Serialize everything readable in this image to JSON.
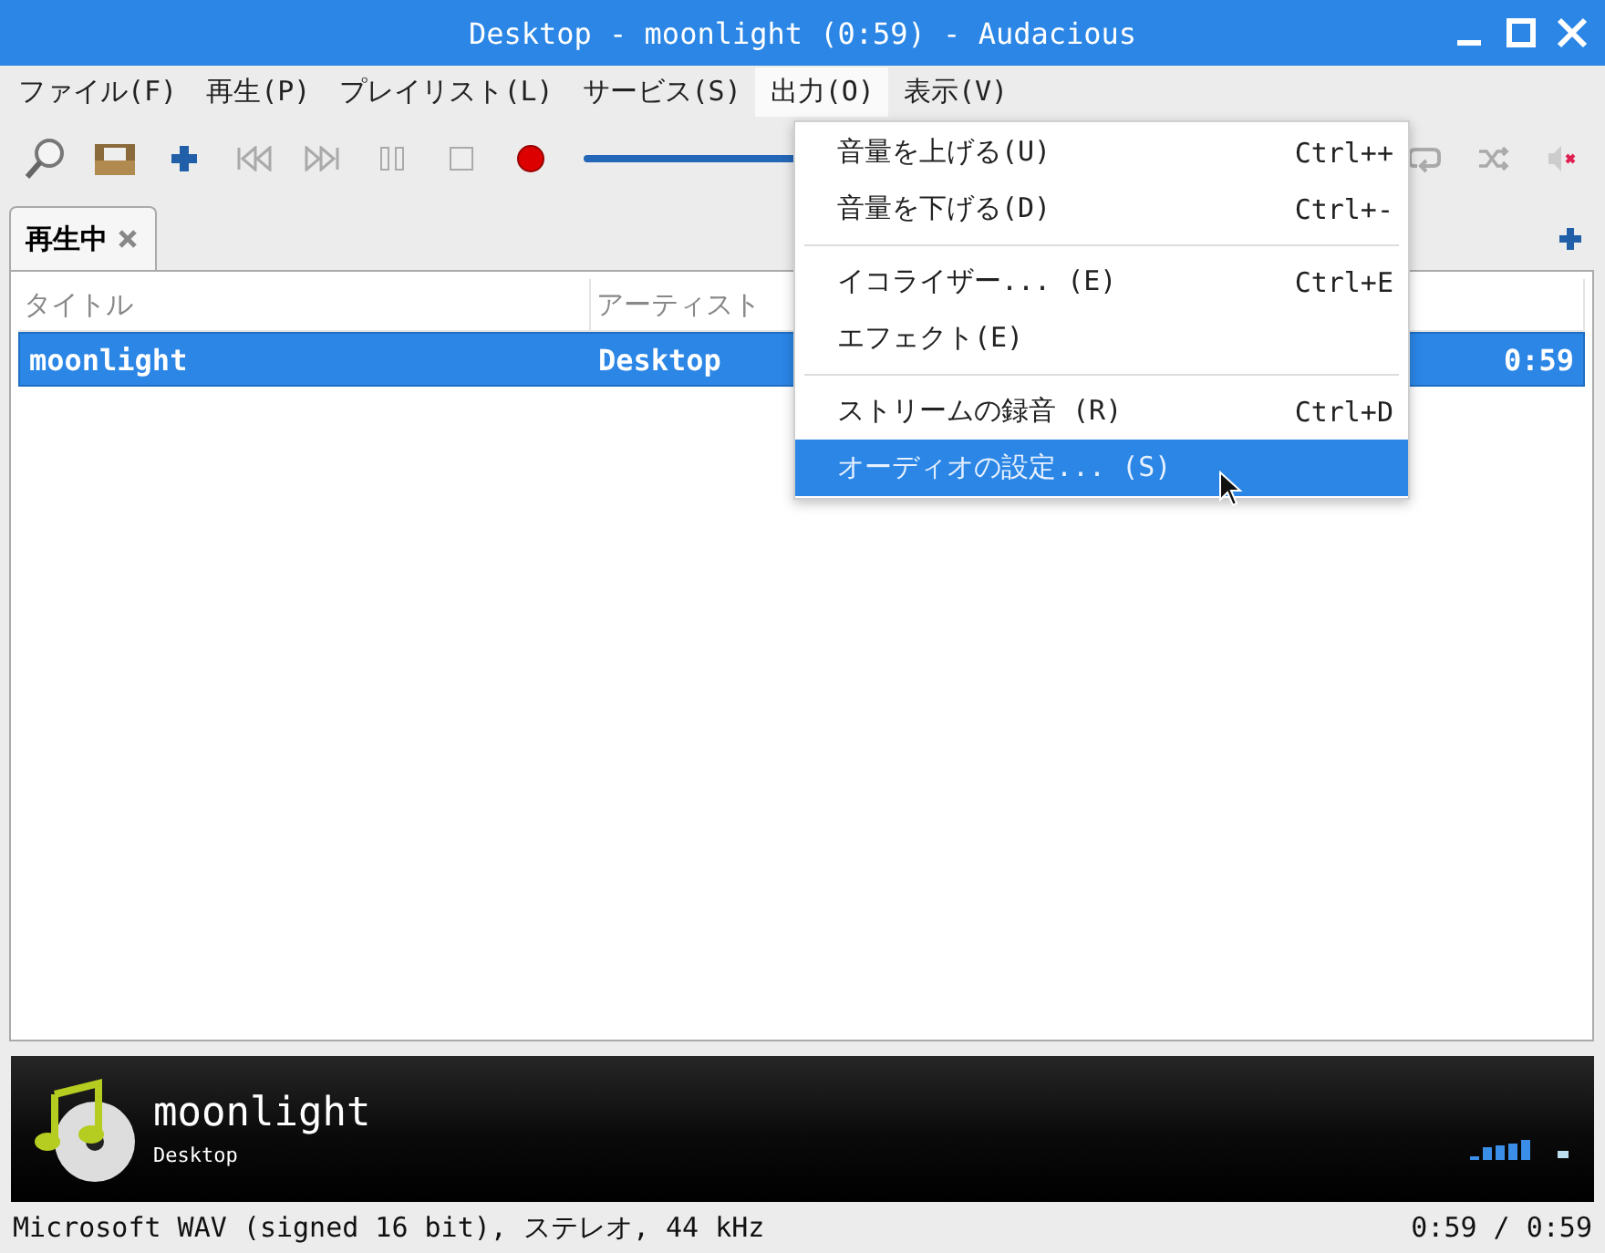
{
  "window": {
    "title": "Desktop - moonlight (0:59) - Audacious"
  },
  "menubar": [
    {
      "label": "ファイル(F)",
      "selected": false
    },
    {
      "label": "再生(P)",
      "selected": false
    },
    {
      "label": "プレイリスト(L)",
      "selected": false
    },
    {
      "label": "サービス(S)",
      "selected": false
    },
    {
      "label": "出力(O)",
      "selected": true
    },
    {
      "label": "表示(V)",
      "selected": false
    }
  ],
  "menu": {
    "items": [
      {
        "kind": "item",
        "label": "音量を上げる(U)",
        "shortcut": "Ctrl++",
        "selected": false
      },
      {
        "kind": "item",
        "label": "音量を下げる(D)",
        "shortcut": "Ctrl+-",
        "selected": false
      },
      {
        "kind": "separator"
      },
      {
        "kind": "item",
        "label": "イコライザー... (E)",
        "shortcut": "Ctrl+E",
        "selected": false
      },
      {
        "kind": "item",
        "label": "エフェクト(E)",
        "selected": false
      },
      {
        "kind": "separator"
      },
      {
        "kind": "item",
        "label": "ストリームの録音 (R)",
        "shortcut": "Ctrl+D",
        "selected": false
      },
      {
        "kind": "item",
        "label": "オーディオの設定... (S)",
        "selected": true
      }
    ]
  },
  "tabs": [
    {
      "label": "再生中",
      "selected": true
    }
  ],
  "playlist": {
    "columns": [
      "タイトル",
      "アーティスト"
    ],
    "rows": [
      {
        "title": "moonlight",
        "artist": "Desktop",
        "column_3": "0:59",
        "selected": true
      }
    ]
  },
  "now_playing": {
    "title": "moonlight",
    "artist": "Desktop"
  },
  "status_bar": {
    "format": "Microsoft WAV (signed 16 bit), ステレオ, 44 kHz",
    "time": "0:59 / 0:59"
  }
}
